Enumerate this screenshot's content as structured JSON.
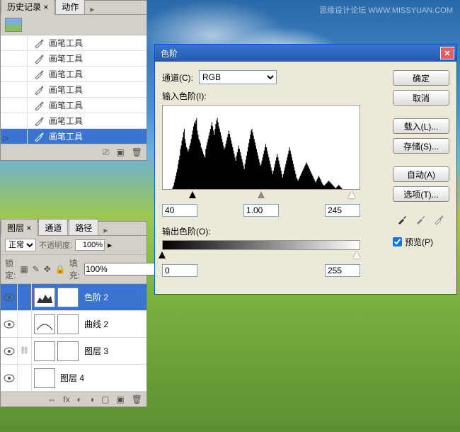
{
  "watermark": "思缘设计论坛  WWW.MISSYUAN.COM",
  "history": {
    "tab_history": "历史记录",
    "tab_actions": "动作",
    "items": [
      {
        "label": "画笔工具"
      },
      {
        "label": "画笔工具"
      },
      {
        "label": "画笔工具"
      },
      {
        "label": "画笔工具"
      },
      {
        "label": "画笔工具"
      },
      {
        "label": "画笔工具"
      },
      {
        "label": "画笔工具"
      }
    ]
  },
  "layers": {
    "tab_layers": "图层",
    "tab_channels": "通道",
    "tab_paths": "路径",
    "blend_mode": "正常",
    "opacity_label": "不透明度:",
    "opacity_value": "100%",
    "lock_label": "锁定:",
    "fill_label": "填充:",
    "fill_value": "100%",
    "items": [
      {
        "name": "色阶 2",
        "selected": true,
        "type": "levels"
      },
      {
        "name": "曲线 2",
        "selected": false,
        "type": "curves"
      },
      {
        "name": "图层 3",
        "selected": false,
        "type": "sky"
      },
      {
        "name": "图层 4",
        "selected": false,
        "type": "lotus"
      }
    ]
  },
  "levels": {
    "title": "色阶",
    "channel_label": "通道(C):",
    "channel_value": "RGB",
    "input_label": "输入色阶(I):",
    "output_label": "输出色阶(O):",
    "shadow": "40",
    "midtone": "1.00",
    "highlight": "245",
    "out_black": "0",
    "out_white": "255",
    "btn_ok": "确定",
    "btn_cancel": "取消",
    "btn_load": "载入(L)...",
    "btn_save": "存储(S)...",
    "btn_auto": "自动(A)",
    "btn_options": "选项(T)...",
    "preview_label": "预览(P)"
  },
  "chart_data": {
    "type": "histogram",
    "title": "输入色阶",
    "xrange": [
      0,
      255
    ],
    "slider_positions": {
      "shadow": 40,
      "midtone_gamma": 1.0,
      "highlight": 245
    },
    "output_range": [
      0,
      255
    ],
    "bins": [
      0,
      0,
      0,
      0,
      0,
      0,
      0,
      0,
      0,
      0,
      0,
      0,
      0,
      2,
      4,
      8,
      12,
      16,
      20,
      24,
      30,
      35,
      40,
      48,
      52,
      58,
      62,
      68,
      72,
      60,
      55,
      50,
      48,
      45,
      48,
      52,
      55,
      60,
      65,
      70,
      75,
      80,
      78,
      82,
      85,
      70,
      65,
      60,
      58,
      55,
      50,
      48,
      45,
      42,
      40,
      38,
      48,
      52,
      56,
      60,
      64,
      68,
      72,
      76,
      80,
      75,
      70,
      65,
      72,
      78,
      82,
      85,
      80,
      75,
      72,
      68,
      64,
      60,
      56,
      52,
      48,
      50,
      54,
      58,
      62,
      66,
      70,
      66,
      62,
      58,
      54,
      50,
      46,
      42,
      38,
      34,
      40,
      44,
      48,
      52,
      48,
      44,
      40,
      36,
      32,
      28,
      24,
      30,
      35,
      40,
      45,
      50,
      55,
      60,
      65,
      70,
      72,
      68,
      64,
      60,
      56,
      52,
      48,
      44,
      40,
      36,
      32,
      28,
      30,
      34,
      38,
      42,
      46,
      50,
      54,
      50,
      46,
      42,
      38,
      34,
      30,
      26,
      22,
      18,
      22,
      26,
      30,
      34,
      38,
      42,
      38,
      34,
      30,
      26,
      22,
      18,
      14,
      18,
      22,
      26,
      30,
      34,
      38,
      42,
      46,
      50,
      46,
      42,
      38,
      34,
      30,
      26,
      22,
      18,
      14,
      12,
      10,
      12,
      14,
      16,
      18,
      20,
      22,
      24,
      26,
      28,
      30,
      32,
      30,
      28,
      26,
      24,
      22,
      20,
      18,
      16,
      14,
      12,
      10,
      8,
      10,
      12,
      14,
      16,
      14,
      12,
      10,
      8,
      6,
      5,
      4,
      5,
      6,
      7,
      8,
      9,
      10,
      9,
      8,
      7,
      6,
      5,
      4,
      3,
      2,
      1,
      2,
      3,
      4,
      5,
      4,
      3,
      2,
      1,
      0,
      0,
      0,
      0,
      0,
      0,
      0,
      0,
      0,
      0,
      0,
      0,
      0,
      0,
      0,
      0,
      0,
      0,
      0,
      0,
      0,
      0
    ]
  }
}
